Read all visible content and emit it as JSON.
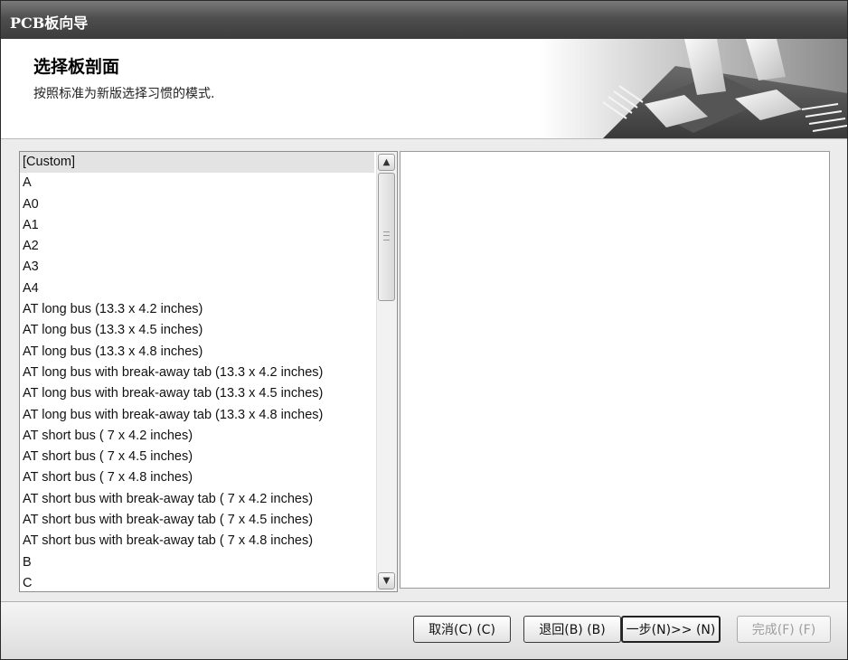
{
  "window": {
    "title": "PCB板向导"
  },
  "header": {
    "title": "选择板剖面",
    "subtitle": "按照标准为新版选择习惯的模式."
  },
  "profile_list": {
    "selected": "[Custom]",
    "items": [
      "[Custom]",
      "A",
      "A0",
      "A1",
      "A2",
      "A3",
      "A4",
      "AT long bus (13.3 x 4.2 inches)",
      "AT long bus (13.3 x 4.5 inches)",
      "AT long bus (13.3 x 4.8 inches)",
      "AT long bus with break-away tab (13.3 x 4.2 inches)",
      "AT long bus with break-away tab (13.3 x 4.5 inches)",
      "AT long bus with break-away tab (13.3 x 4.8 inches)",
      "AT short bus ( 7 x 4.2 inches)",
      "AT short bus ( 7 x 4.5 inches)",
      "AT short bus ( 7 x 4.8 inches)",
      "AT short bus with break-away tab ( 7 x 4.2 inches)",
      "AT short bus with break-away tab ( 7 x 4.5 inches)",
      "AT short bus with break-away tab ( 7 x 4.8 inches)",
      "B",
      "C"
    ]
  },
  "buttons": {
    "cancel": "取消(C) (C)",
    "back": "退回(B) (B)",
    "next": "一步(N)>> (N)",
    "finish": "完成(F) (F)"
  },
  "icons": {
    "scroll_up": "chevron-up-icon",
    "scroll_down": "chevron-down-icon",
    "header_art": "pcb-chip-graphic"
  }
}
